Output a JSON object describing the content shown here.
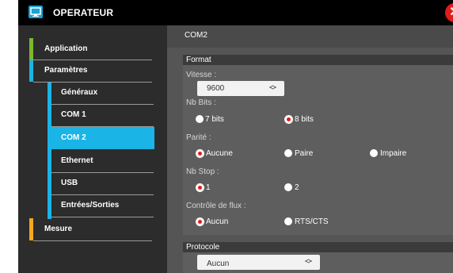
{
  "window": {
    "title": "OPERATEUR",
    "close_label": "✕"
  },
  "sidebar": {
    "items": [
      {
        "label": "Application",
        "accent": "#7cb82f"
      },
      {
        "label": "Paramètres",
        "accent": "#1ab4e6"
      },
      {
        "label": "Généraux"
      },
      {
        "label": "COM 1"
      },
      {
        "label": "COM 2",
        "selected": true
      },
      {
        "label": "Ethernet"
      },
      {
        "label": "USB"
      },
      {
        "label": "Entrées/Sorties"
      },
      {
        "label": "Mesure",
        "accent": "#f5a623"
      }
    ]
  },
  "content": {
    "header": "COM2",
    "format": {
      "title": "Format",
      "vitesse": {
        "label": "Vitesse :",
        "value": "9600"
      },
      "nb_bits": {
        "label": "Nb Bits :",
        "options": [
          "7 bits",
          "8 bits"
        ],
        "selected": "8 bits"
      },
      "parite": {
        "label": "Parité :",
        "options": [
          "Aucune",
          "Paire",
          "Impaire"
        ],
        "selected": "Aucune"
      },
      "nb_stop": {
        "label": "Nb Stop :",
        "options": [
          "1",
          "2"
        ],
        "selected": "1"
      },
      "controle": {
        "label": "Contrôle de flux :",
        "options": [
          "Aucun",
          "RTS/CTS"
        ],
        "selected": "Aucun"
      }
    },
    "protocole": {
      "title": "Protocole",
      "value": "Aucun"
    }
  },
  "colors": {
    "accent": "#1ab4e6",
    "radio_selected": "#e01d1d",
    "close": "#e21b1b"
  },
  "icons": {
    "app": "monitor-icon",
    "close": "close-icon",
    "spinner": "up-down-chevron-icon"
  }
}
